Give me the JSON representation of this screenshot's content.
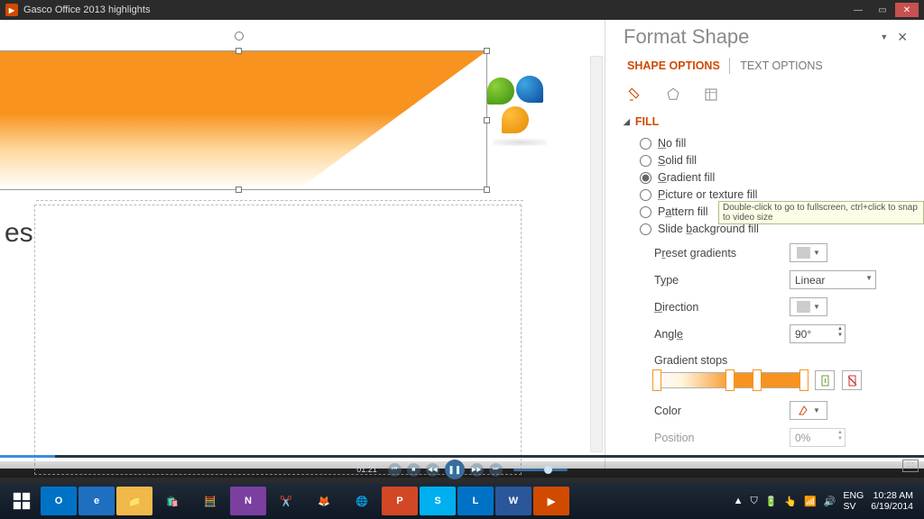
{
  "player": {
    "title": "Gasco Office 2013 highlights",
    "time": "01:21",
    "tooltip": "Double-click to go to fullscreen, ctrl+click to snap to video size"
  },
  "pane": {
    "title": "Format Shape",
    "tabs": {
      "shape": "SHAPE OPTIONS",
      "text": "TEXT OPTIONS"
    },
    "section_fill": "FILL",
    "fill_opts": {
      "none": "No fill",
      "solid": "Solid fill",
      "gradient": "Gradient fill",
      "picture": "Picture or texture fill",
      "pattern": "Pattern fill",
      "slidebg": "Slide background fill"
    },
    "rows": {
      "preset": "Preset gradients",
      "type": "Type",
      "type_val": "Linear",
      "direction": "Direction",
      "angle": "Angle",
      "angle_val": "90°",
      "stops": "Gradient stops",
      "color": "Color",
      "position": "Position",
      "position_val": "0%"
    }
  },
  "slide": {
    "text_fragment": "es"
  },
  "taskbar": {
    "tray": {
      "lang1": "ENG",
      "lang2": "SV",
      "time": "10:28 AM",
      "date": "6/19/2014"
    }
  }
}
